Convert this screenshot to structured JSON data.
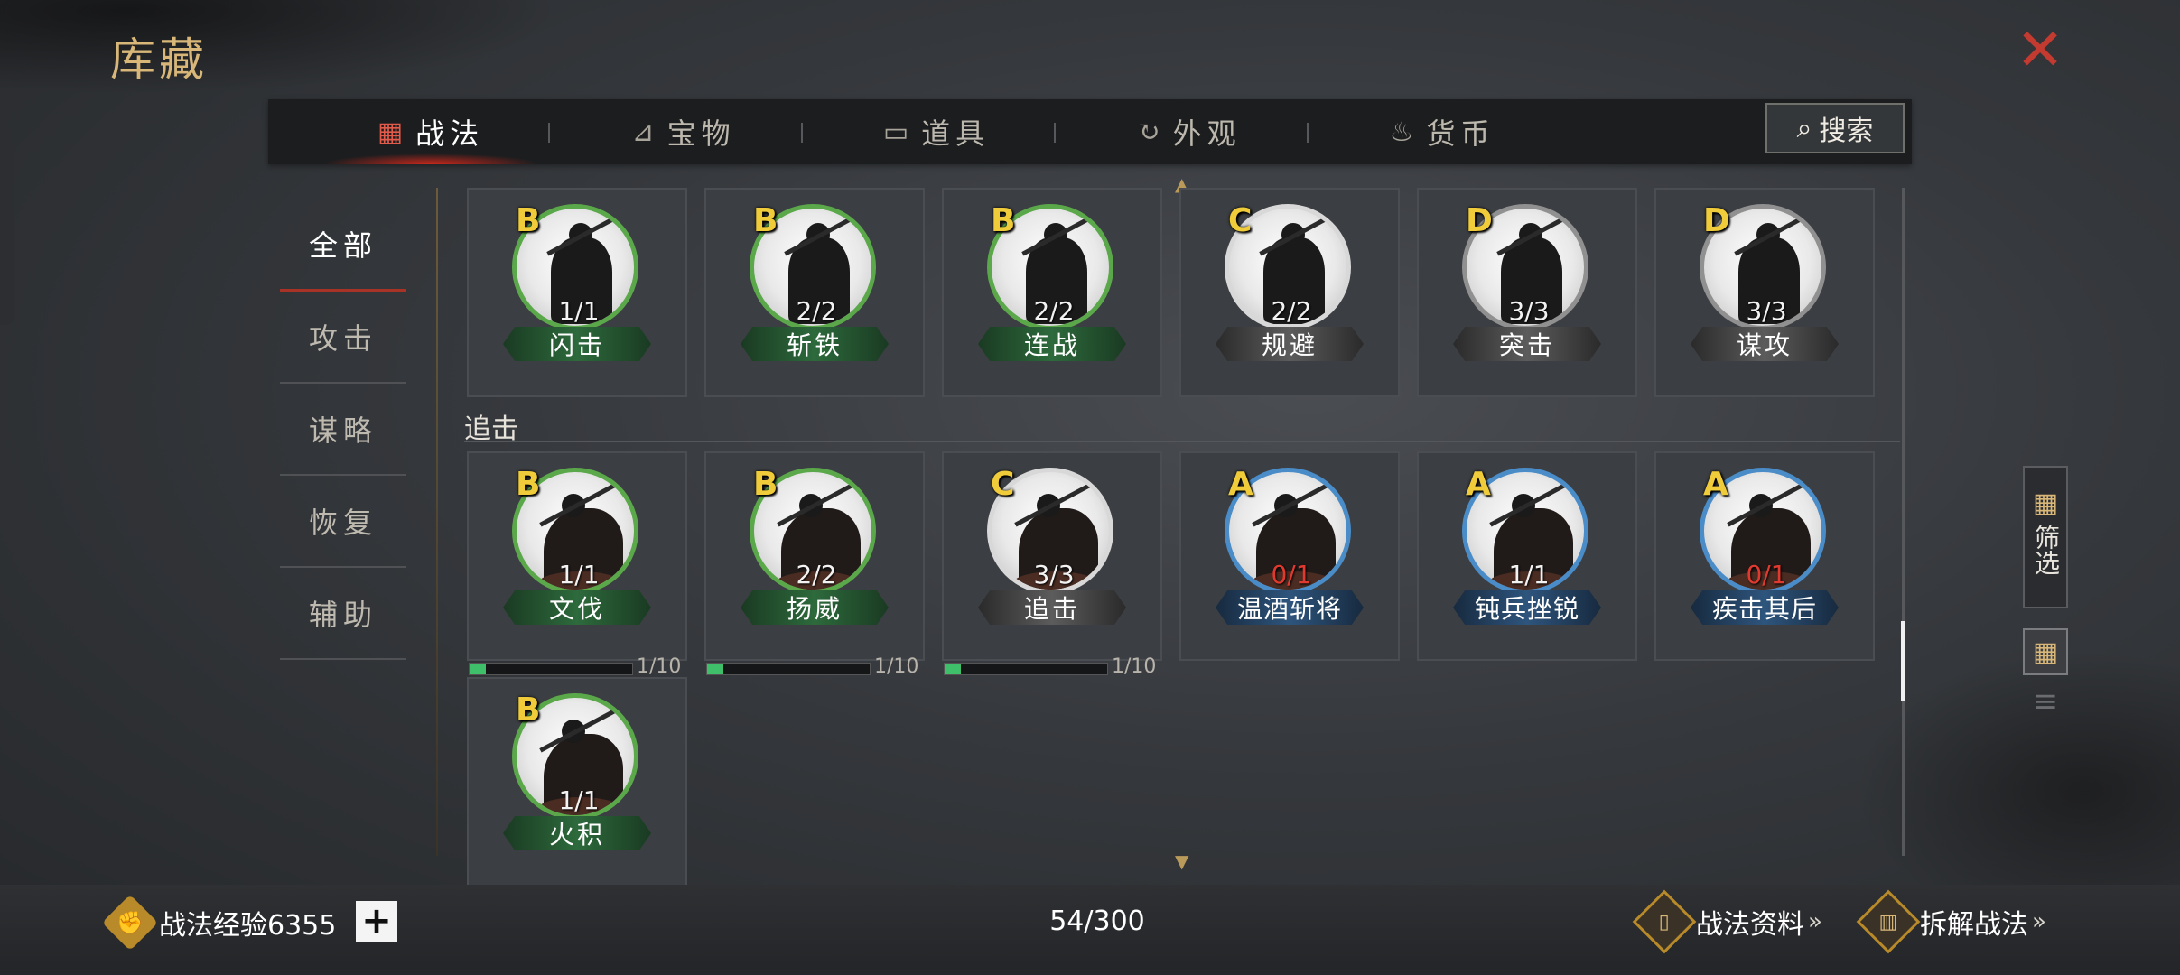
{
  "title": "库藏",
  "tabs": [
    {
      "label": "战法",
      "icon": "scroll-bundle-icon",
      "active": true
    },
    {
      "label": "宝物",
      "icon": "crossbow-icon",
      "active": false
    },
    {
      "label": "道具",
      "icon": "chest-icon",
      "active": false
    },
    {
      "label": "外观",
      "icon": "swirl-icon",
      "active": false
    },
    {
      "label": "货币",
      "icon": "coin-bag-icon",
      "active": false
    }
  ],
  "search": {
    "label": "搜索"
  },
  "side_nav": [
    {
      "label": "全部",
      "active": true
    },
    {
      "label": "攻击",
      "active": false
    },
    {
      "label": "谋略",
      "active": false
    },
    {
      "label": "恢复",
      "active": false
    },
    {
      "label": "辅助",
      "active": false
    }
  ],
  "rows": {
    "top": [
      {
        "grade": "B",
        "count": "1/1",
        "name": "闪击",
        "style": "green"
      },
      {
        "grade": "B",
        "count": "2/2",
        "name": "斩铁",
        "style": "green"
      },
      {
        "grade": "B",
        "count": "2/2",
        "name": "连战",
        "style": "green"
      },
      {
        "grade": "C",
        "count": "2/2",
        "name": "规避",
        "style": "gray"
      },
      {
        "grade": "D",
        "count": "3/3",
        "name": "突击",
        "style": "gray-d"
      },
      {
        "grade": "D",
        "count": "3/3",
        "name": "谋攻",
        "style": "gray-d"
      }
    ],
    "section_label": "追击",
    "middle": [
      {
        "grade": "B",
        "count": "1/1",
        "name": "文伐",
        "style": "green",
        "progress": {
          "label": "1/10",
          "value": 0.1
        }
      },
      {
        "grade": "B",
        "count": "2/2",
        "name": "扬威",
        "style": "green",
        "progress": {
          "label": "1/10",
          "value": 0.1
        }
      },
      {
        "grade": "C",
        "count": "3/3",
        "name": "追击",
        "style": "gray",
        "progress": {
          "label": "1/10",
          "value": 0.1
        }
      },
      {
        "grade": "A",
        "count": "0/1",
        "name": "温酒斩将",
        "style": "blue"
      },
      {
        "grade": "A",
        "count": "1/1",
        "name": "钝兵挫锐",
        "style": "blue"
      },
      {
        "grade": "A",
        "count": "0/1",
        "name": "疾击其后",
        "style": "blue"
      }
    ],
    "bottom": [
      {
        "grade": "B",
        "count": "1/1",
        "name": "火积",
        "style": "green"
      }
    ]
  },
  "filter": {
    "label": "筛选"
  },
  "footer": {
    "exp_label": "战法经验6355",
    "plus": "+",
    "capacity": "54/300",
    "info_link": "战法资料",
    "disassemble_link": "拆解战法",
    "chevrons": "»"
  },
  "colors": {
    "title_gold": "#d8b779",
    "close_red": "#c23a30",
    "grade_yellow": "#f0cc3a",
    "active_tab_glow": "#c8281c",
    "progress_green": "#3fbf6a"
  }
}
